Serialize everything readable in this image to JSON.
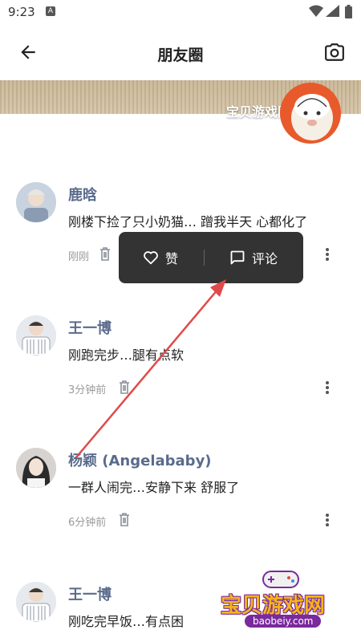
{
  "status_bar": {
    "time": "9:23",
    "notif_badge": "A"
  },
  "appbar": {
    "title": "朋友圈"
  },
  "cover": {
    "name": "宝贝游戏网"
  },
  "popup": {
    "like_label": "赞",
    "comment_label": "评论"
  },
  "posts": [
    {
      "name": "鹿晗",
      "content": "刚楼下捡了只小奶猫… 蹭我半天 心都化了",
      "time": "刚刚"
    },
    {
      "name": "王一博",
      "content": "刚跑完步…腿有点软",
      "time": "3分钟前"
    },
    {
      "name": "杨颖 (Angelababy)",
      "content": "一群人闹完…安静下来 舒服了",
      "time": "6分钟前"
    },
    {
      "name": "王一博",
      "content": "刚吃完早饭…有点困",
      "time": ""
    }
  ],
  "watermark": {
    "title": "宝贝游戏网",
    "url": "baobeiy.com"
  },
  "colors": {
    "accent_name": "#5a6b8c",
    "popup_bg": "#333333",
    "arrow": "#e04a4a"
  }
}
